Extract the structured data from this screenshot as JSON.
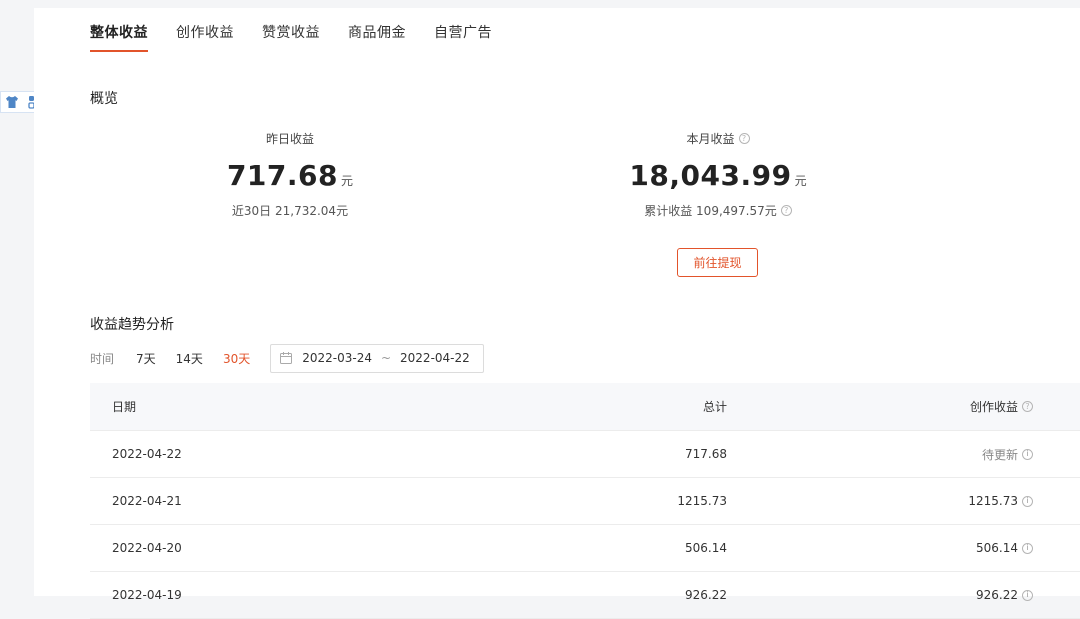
{
  "tabs": [
    {
      "label": "整体收益",
      "active": true
    },
    {
      "label": "创作收益",
      "active": false
    },
    {
      "label": "赞赏收益",
      "active": false
    },
    {
      "label": "商品佣金",
      "active": false
    },
    {
      "label": "自营广告",
      "active": false
    }
  ],
  "overview": {
    "title": "概览",
    "yesterday": {
      "label": "昨日收益",
      "value": "717.68",
      "unit": "元",
      "sub": "近30日 21,732.04元"
    },
    "month": {
      "label": "本月收益",
      "value": "18,043.99",
      "unit": "元",
      "sub": "累计收益 109,497.57元"
    },
    "withdraw_label": "前往提现"
  },
  "trend": {
    "title": "收益趋势分析",
    "time_label": "时间",
    "ranges": [
      {
        "label": "7天",
        "active": false
      },
      {
        "label": "14天",
        "active": false
      },
      {
        "label": "30天",
        "active": true
      }
    ],
    "date_start": "2022-03-24",
    "date_sep": "~",
    "date_end": "2022-04-22"
  },
  "table": {
    "headers": {
      "date": "日期",
      "total": "总计",
      "creation": "创作收益"
    },
    "rows": [
      {
        "date": "2022-04-22",
        "total": "717.68",
        "creation": "待更新"
      },
      {
        "date": "2022-04-21",
        "total": "1215.73",
        "creation": "1215.73"
      },
      {
        "date": "2022-04-20",
        "total": "506.14",
        "creation": "506.14"
      },
      {
        "date": "2022-04-19",
        "total": "926.22",
        "creation": "926.22"
      }
    ]
  },
  "colors": {
    "accent": "#e2542b",
    "header_bg": "#f7f8fa",
    "icon_blue": "#4f86c6"
  },
  "icons": {
    "help": "question-circle-icon",
    "info": "info-circle-icon",
    "calendar": "calendar-icon",
    "tool_a": "shirt-icon",
    "tool_b": "grid-icon"
  }
}
